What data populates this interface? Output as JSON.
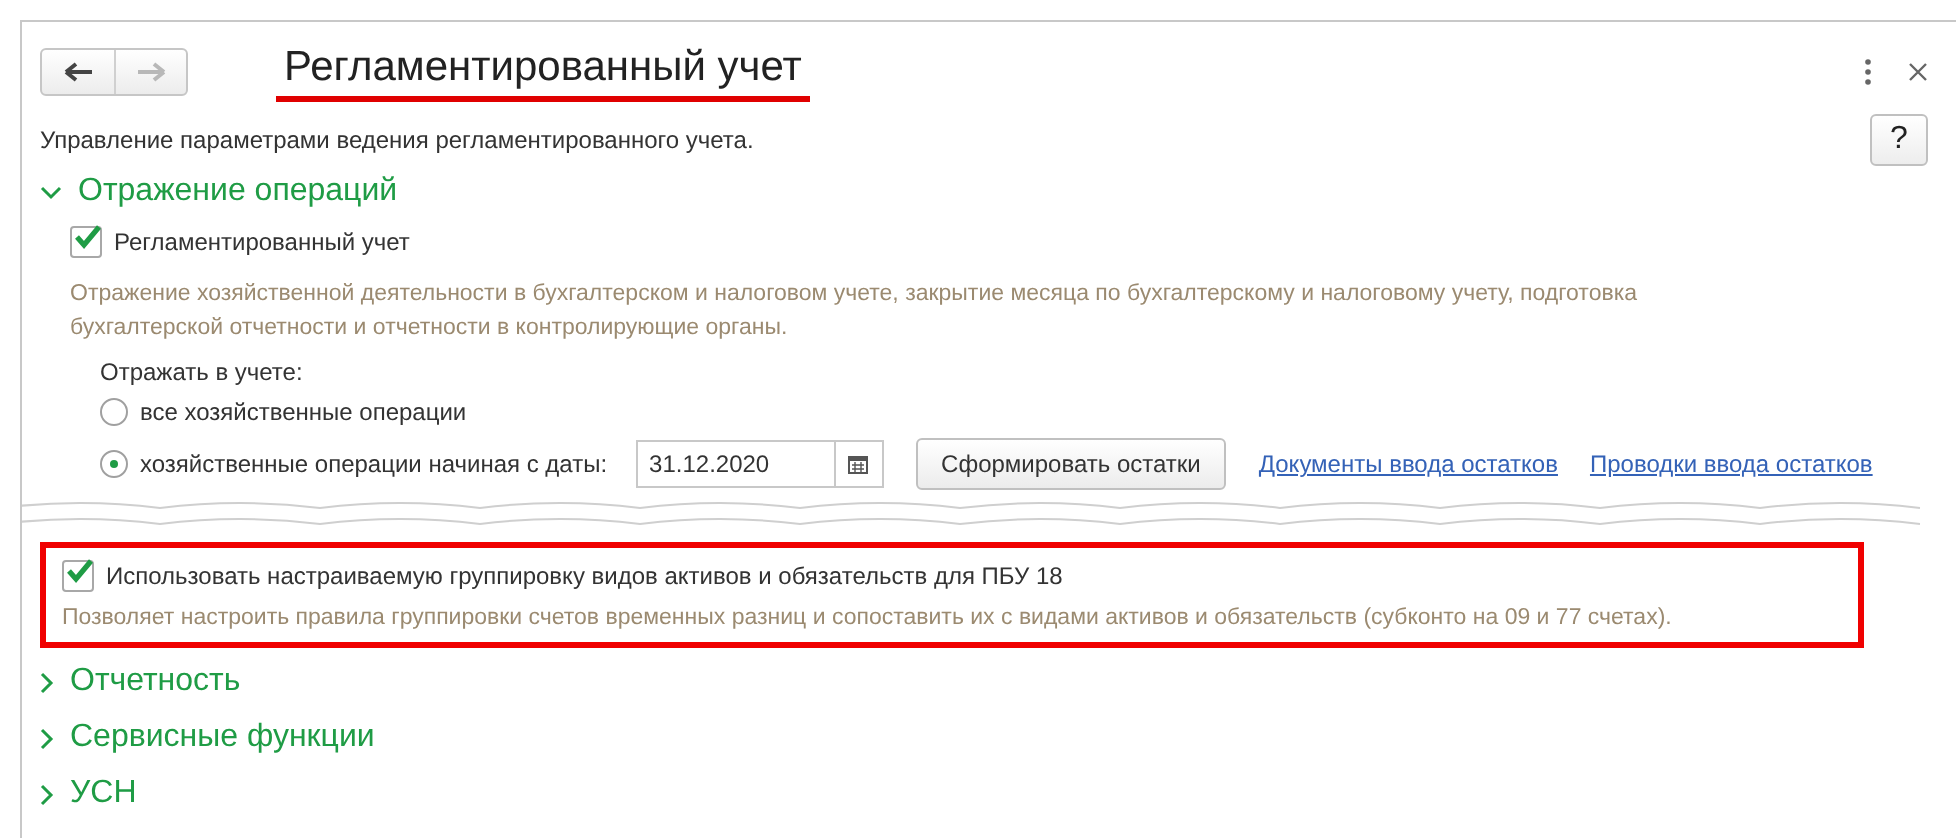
{
  "window": {
    "title": "Регламентированный учет",
    "nav": [
      {
        "kind": "back",
        "disabled": false
      },
      {
        "kind": "forward",
        "disabled": true
      }
    ],
    "help_button": "?"
  },
  "description": "Управление параметрами ведения регламентированного учета.",
  "group": {
    "title": "Отражение операций",
    "expanded": true,
    "checkbox": {
      "label": "Регламентированный учет",
      "checked": true
    },
    "hint": "Отражение хозяйственной деятельности в бухгалтерском и налоговом учете, закрытие месяца по бухгалтерскому и налоговому учету, подготовка бухгалтерской отчетности и отчетности в контролирующие органы.",
    "radio_label": "Отражать в учете:",
    "radios": [
      {
        "label": "все хозяйственные операции",
        "selected": false
      },
      {
        "label": "хозяйственные операции начиная с даты:",
        "selected": true
      }
    ],
    "date": "31.12.2020",
    "button": "Сформировать остатки",
    "links": [
      "Документы ввода остатков",
      "Проводки ввода остатков"
    ]
  },
  "highlighted": {
    "checkbox": {
      "label": "Использовать настраиваемую группировку видов активов и обязательств для ПБУ 18",
      "checked": true
    },
    "hint": "Позволяет настроить правила группировки счетов временных разниц и сопоставить их с видами активов и обязательств (субконто на 09 и 77 счетах)."
  },
  "groups": [
    {
      "title": "Отчетность",
      "expanded": false
    },
    {
      "title": "Сервисные функции",
      "expanded": false
    },
    {
      "title": "УСН",
      "expanded": false
    }
  ]
}
